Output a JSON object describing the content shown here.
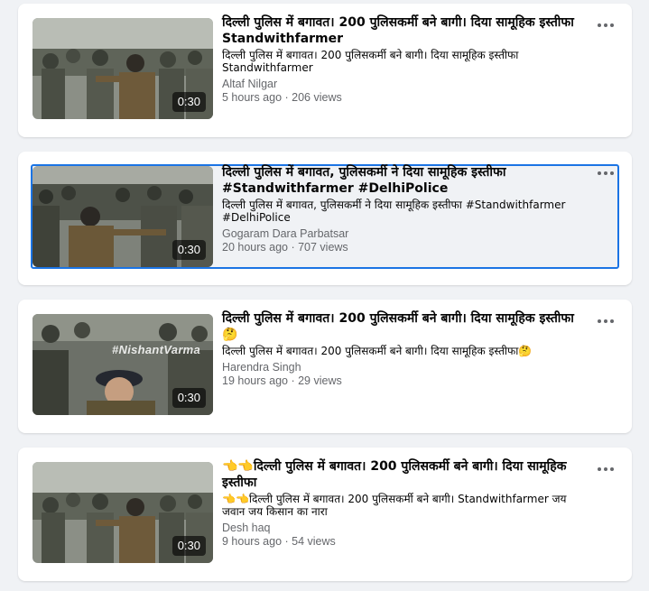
{
  "colors": {
    "page_bg": "#f0f2f5",
    "card_bg": "#ffffff",
    "focus_outline": "#1b74e4",
    "meta_text": "#65676b"
  },
  "videos": [
    {
      "title": "दिल्ली पुलिस में बगावत। 200 पुलिसकर्मी बने बागी। दिया सामूहिक इस्तीफा Standwithfarmer",
      "description": "दिल्ली पुलिस में बगावत। 200 पुलिसकर्मी बने बागी। दिया सामूहिक इस्तीफा Standwithfarmer",
      "author": "Altaf Nilgar",
      "meta": "5 hours ago · 206 views",
      "duration": "0:30",
      "more_icon": "more-horizontal-icon"
    },
    {
      "title": "दिल्ली पुलिस में बगावत, पुलिसकर्मी ने दिया सामूहिक इस्तीफा #Standwithfarmer #DelhiPolice",
      "description": "दिल्ली पुलिस में बगावत, पुलिसकर्मी ने दिया सामूहिक इस्तीफा #Standwithfarmer #DelhiPolice",
      "author": "Gogaram Dara Parbatsar",
      "meta": "20 hours ago · 707 views",
      "duration": "0:30",
      "more_icon": "more-horizontal-icon"
    },
    {
      "title": "दिल्ली पुलिस में बगावत। 200 पुलिसकर्मी बने बागी। दिया सामूहिक इस्तीफा 🤔",
      "description": "दिल्ली पुलिस में बगावत। 200 पुलिसकर्मी बने बागी। दिया सामूहिक इस्तीफा🤔",
      "author": "Harendra Singh",
      "meta": "19 hours ago · 29 views",
      "duration": "0:30",
      "watermark": "#NishantVarma",
      "more_icon": "more-horizontal-icon"
    },
    {
      "title": "👈👈दिल्ली पुलिस में बगावत। 200 पुलिसकर्मी बने बागी। दिया सामूहिक इस्तीफा",
      "description": "👈👈दिल्ली पुलिस में बगावत। 200 पुलिसकर्मी बने बागी। Standwithfarmer जय जवान जय किसान का नारा",
      "author": "Desh haq",
      "meta": "9 hours ago · 54 views",
      "duration": "0:30",
      "more_icon": "more-horizontal-icon"
    }
  ]
}
